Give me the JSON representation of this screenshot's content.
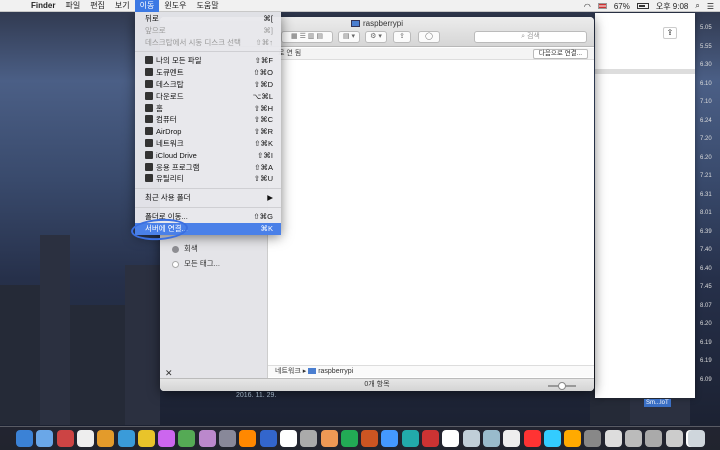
{
  "menubar": {
    "app_name": "Finder",
    "items": [
      "파일",
      "편집",
      "보기",
      "이동",
      "윈도우",
      "도움말"
    ],
    "battery": "67%",
    "clock": "오후 9:08"
  },
  "finder": {
    "title": "raspberrypi",
    "search_placeholder": "검색",
    "header_text": "로 연 됨",
    "connect_as_label": "다음으로 연결...",
    "sidebar_tags": [
      "회색",
      "모든 태그..."
    ],
    "path_network": "네트워크",
    "path_host": "raspberrypi",
    "status": "0개 항목"
  },
  "go_menu": {
    "items": [
      {
        "label": "뒤로",
        "shortcut": "⌘[",
        "enabled": true
      },
      {
        "label": "앞으로",
        "shortcut": "⌘]",
        "enabled": false
      },
      {
        "label": "데스크탑에서 시동 디스크 선택",
        "shortcut": "⇧⌘↑",
        "enabled": false
      },
      {
        "label": "나의 모든 파일",
        "shortcut": "⇧⌘F",
        "enabled": true,
        "icon": "all-files-icon"
      },
      {
        "label": "도큐멘트",
        "shortcut": "⇧⌘O",
        "enabled": true,
        "icon": "documents-icon"
      },
      {
        "label": "데스크탑",
        "shortcut": "⇧⌘D",
        "enabled": true,
        "icon": "desktop-icon"
      },
      {
        "label": "다운로드",
        "shortcut": "⌥⌘L",
        "enabled": true,
        "icon": "downloads-icon"
      },
      {
        "label": "홈",
        "shortcut": "⇧⌘H",
        "enabled": true,
        "icon": "home-icon"
      },
      {
        "label": "컴퓨터",
        "shortcut": "⇧⌘C",
        "enabled": true,
        "icon": "computer-icon"
      },
      {
        "label": "AirDrop",
        "shortcut": "⇧⌘R",
        "enabled": true,
        "icon": "airdrop-icon"
      },
      {
        "label": "네트워크",
        "shortcut": "⇧⌘K",
        "enabled": true,
        "icon": "network-icon"
      },
      {
        "label": "iCloud Drive",
        "shortcut": "⇧⌘I",
        "enabled": true,
        "icon": "icloud-icon"
      },
      {
        "label": "응용 프로그램",
        "shortcut": "⇧⌘A",
        "enabled": true,
        "icon": "applications-icon"
      },
      {
        "label": "유틸리티",
        "shortcut": "⇧⌘U",
        "enabled": true,
        "icon": "utilities-icon"
      },
      {
        "label": "최근 사용 폴더",
        "shortcut": "▶",
        "enabled": true
      },
      {
        "label": "폴더로 이동...",
        "shortcut": "⇧⌘G",
        "enabled": true
      },
      {
        "label": "서버에 연결...",
        "shortcut": "⌘K",
        "enabled": true,
        "highlighted": true
      }
    ]
  },
  "right_numbers": [
    "5.05",
    "5.55",
    "6.30",
    "6.10",
    "7.10",
    "6.24",
    "7.20",
    "6.20",
    "7.21",
    "6.31",
    "8.01",
    "6.39",
    "7.40",
    "6.40",
    "7.45",
    "8.07",
    "6.20",
    "6.19",
    "6.19",
    "6.09"
  ],
  "desktop": {
    "date_stamp": "2016. 11. 29.",
    "item_label": "Sm...IoT"
  },
  "colors": {
    "highlight": "#4a80e8",
    "annotation_circle": "#3b6fe0"
  }
}
